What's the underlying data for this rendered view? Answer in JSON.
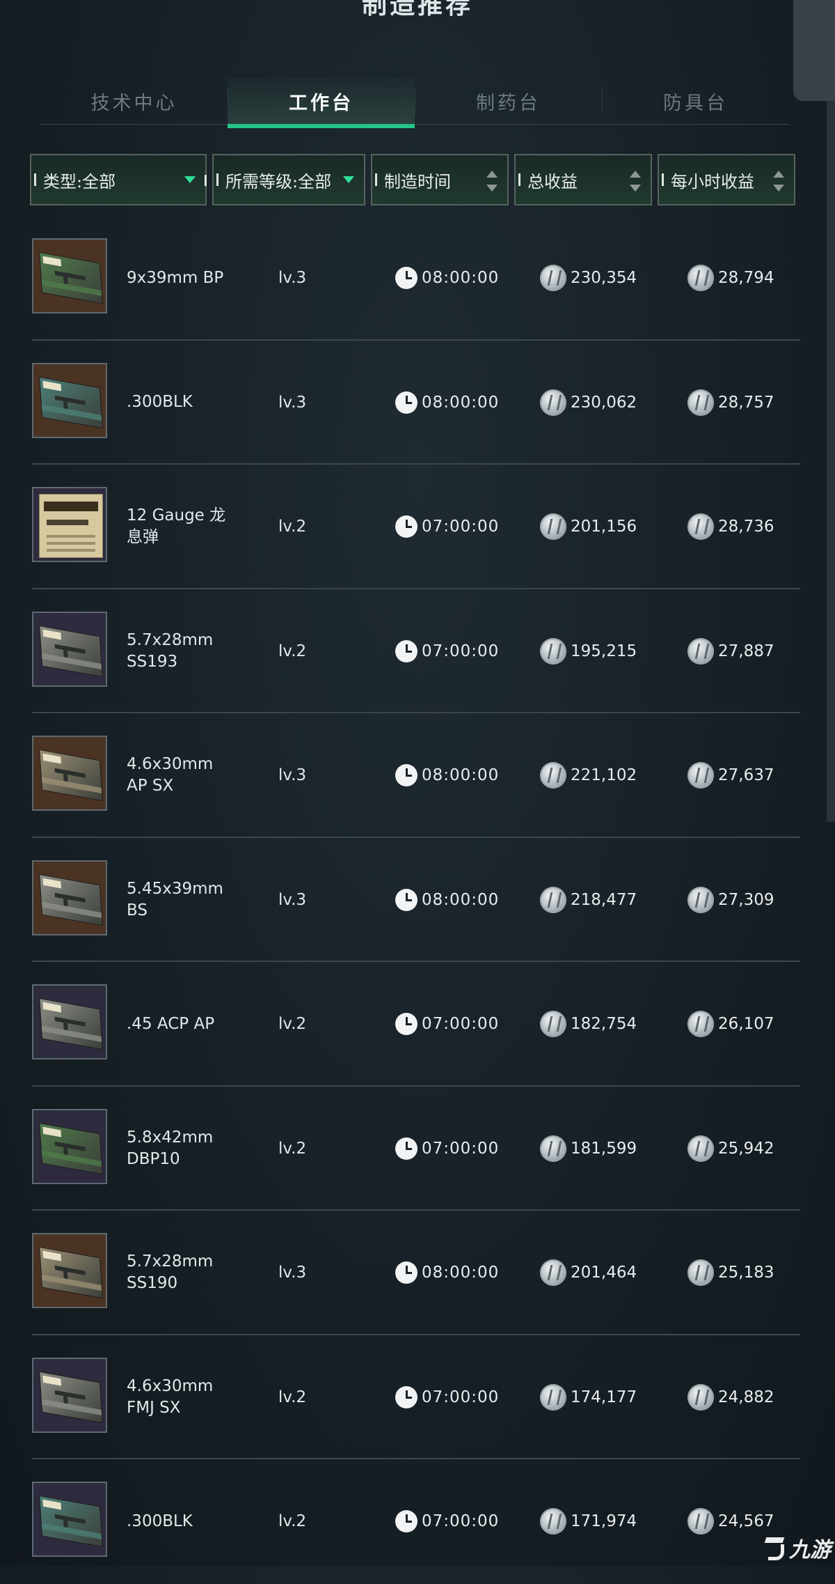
{
  "header": {
    "title": "制造推荐"
  },
  "tabs": [
    {
      "label": "技术中心",
      "active": false
    },
    {
      "label": "工作台",
      "active": true
    },
    {
      "label": "制药台",
      "active": false
    },
    {
      "label": "防具台",
      "active": false
    }
  ],
  "filters": {
    "type": "类型:全部",
    "level": "所需等级:全部",
    "time": "制造时间",
    "total": "总收益",
    "hourly": "每小时收益"
  },
  "items": [
    {
      "name": "9x39mm BP",
      "level": "lv.3",
      "time": "08:00:00",
      "total": "230,354",
      "hourly": "28,794",
      "icon": "ammo-box-green",
      "bg": "brown"
    },
    {
      "name": ".300BLK",
      "level": "lv.3",
      "time": "08:00:00",
      "total": "230,062",
      "hourly": "28,757",
      "icon": "ammo-box-teal",
      "bg": "brown"
    },
    {
      "name": "12 Gauge 龙息弹",
      "level": "lv.2",
      "time": "07:00:00",
      "total": "201,156",
      "hourly": "28,736",
      "icon": "shell-carton",
      "bg": "purple"
    },
    {
      "name": "5.7x28mm SS193",
      "level": "lv.2",
      "time": "07:00:00",
      "total": "195,215",
      "hourly": "27,887",
      "icon": "ammo-box-gray",
      "bg": "purple"
    },
    {
      "name": "4.6x30mm AP SX",
      "level": "lv.3",
      "time": "08:00:00",
      "total": "221,102",
      "hourly": "27,637",
      "icon": "ammo-box-tan",
      "bg": "brown"
    },
    {
      "name": "5.45x39mm BS",
      "level": "lv.3",
      "time": "08:00:00",
      "total": "218,477",
      "hourly": "27,309",
      "icon": "ammo-box-gray",
      "bg": "brown"
    },
    {
      "name": ".45 ACP AP",
      "level": "lv.2",
      "time": "07:00:00",
      "total": "182,754",
      "hourly": "26,107",
      "icon": "ammo-box-gray",
      "bg": "purple"
    },
    {
      "name": "5.8x42mm DBP10",
      "level": "lv.2",
      "time": "07:00:00",
      "total": "181,599",
      "hourly": "25,942",
      "icon": "ammo-box-green",
      "bg": "purple"
    },
    {
      "name": "5.7x28mm SS190",
      "level": "lv.3",
      "time": "08:00:00",
      "total": "201,464",
      "hourly": "25,183",
      "icon": "ammo-box-tan",
      "bg": "brown"
    },
    {
      "name": "4.6x30mm FMJ SX",
      "level": "lv.2",
      "time": "07:00:00",
      "total": "174,177",
      "hourly": "24,882",
      "icon": "ammo-box-gray",
      "bg": "purple"
    },
    {
      "name": ".300BLK",
      "level": "lv.2",
      "time": "07:00:00",
      "total": "171,974",
      "hourly": "24,567",
      "icon": "ammo-box-teal",
      "bg": "purple"
    }
  ],
  "colors": {
    "accent": "#25c489",
    "background": "#172026",
    "divider": "#3c474c",
    "box_green": "#4f7a4a",
    "box_teal": "#4c7f77",
    "box_gray": "#8b8e86",
    "box_tan": "#9a8f74"
  },
  "watermark": {
    "text": "九游"
  }
}
